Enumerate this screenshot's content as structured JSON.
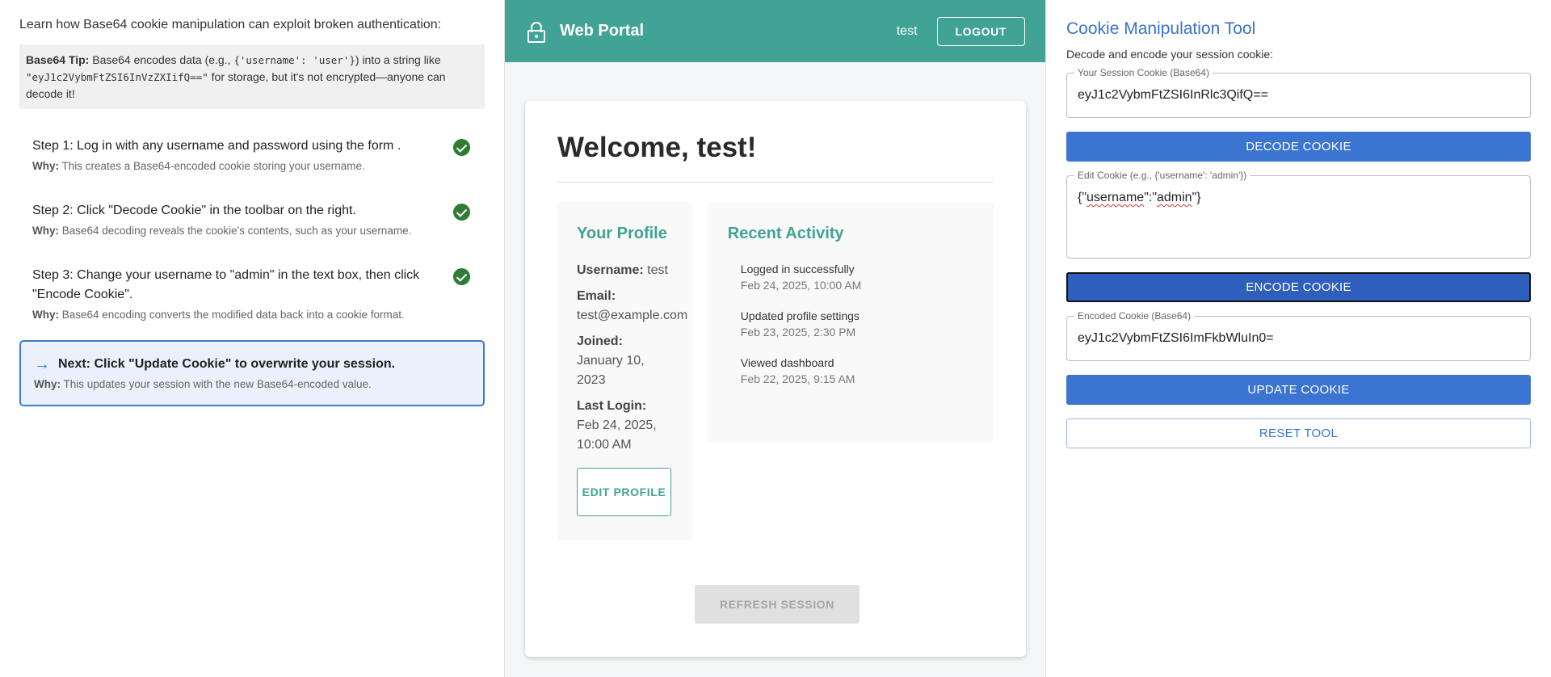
{
  "left": {
    "intro": "Learn how Base64 cookie manipulation can exploit broken authentication:",
    "tip": {
      "label": "Base64 Tip:",
      "text1": " Base64 encodes data (e.g., ",
      "code1": "{'username': 'user'}",
      "text2": ") into a string like ",
      "code2": "\"eyJ1c2VybmFtZSI6InVzZXIifQ==\"",
      "text3": " for storage, but it's not encrypted—anyone can decode it!"
    },
    "why_label": "Why:",
    "steps": [
      {
        "title": "Step 1: Log in with any username and password using the form .",
        "why": " This creates a Base64-encoded cookie storing your username."
      },
      {
        "title": "Step 2: Click \"Decode Cookie\" in the toolbar on the right.",
        "why": " Base64 decoding reveals the cookie's contents, such as your username."
      },
      {
        "title": "Step 3: Change your username to \"admin\" in the text box, then click \"Encode Cookie\".",
        "why": " Base64 encoding converts the modified data back into a cookie format."
      }
    ],
    "next": {
      "title": "Next: Click \"Update Cookie\" to overwrite your session.",
      "why": " This updates your session with the new Base64-encoded value."
    }
  },
  "portal": {
    "brand": "Web Portal",
    "user": "test",
    "logout_label": "LOGOUT",
    "welcome": "Welcome, test!",
    "profile": {
      "title": "Your Profile",
      "username_label": "Username:",
      "username": " test",
      "email_label": "Email:",
      "email": "test@example.com",
      "joined_label": "Joined:",
      "joined": "January 10, 2023",
      "last_login_label": "Last Login:",
      "last_login": "Feb 24, 2025, 10:00 AM",
      "edit_label": "EDIT PROFILE"
    },
    "activity": {
      "title": "Recent Activity",
      "items": [
        {
          "title": "Logged in successfully",
          "date": "Feb 24, 2025, 10:00 AM"
        },
        {
          "title": "Updated profile settings",
          "date": "Feb 23, 2025, 2:30 PM"
        },
        {
          "title": "Viewed dashboard",
          "date": "Feb 22, 2025, 9:15 AM"
        }
      ]
    },
    "refresh_label": "REFRESH SESSION"
  },
  "tool": {
    "title": "Cookie Manipulation Tool",
    "subtitle": "Decode and encode your session cookie:",
    "session_label": "Your Session Cookie (Base64)",
    "session_value": "eyJ1c2VybmFtZSI6InRlc3QifQ==",
    "decode_label": "DECODE COOKIE",
    "edit_label": "Edit Cookie (e.g., {'username': 'admin'})",
    "edit_value_a": "{\"",
    "edit_value_b": "username",
    "edit_value_c": "\":\"",
    "edit_value_d": "admin",
    "edit_value_e": "\"}",
    "encode_label": "ENCODE COOKIE",
    "encoded_label": "Encoded Cookie (Base64)",
    "encoded_value": "eyJ1c2VybmFtZSI6ImFkbWluIn0=",
    "update_label": "UPDATE COOKIE",
    "reset_label": "RESET TOOL"
  }
}
